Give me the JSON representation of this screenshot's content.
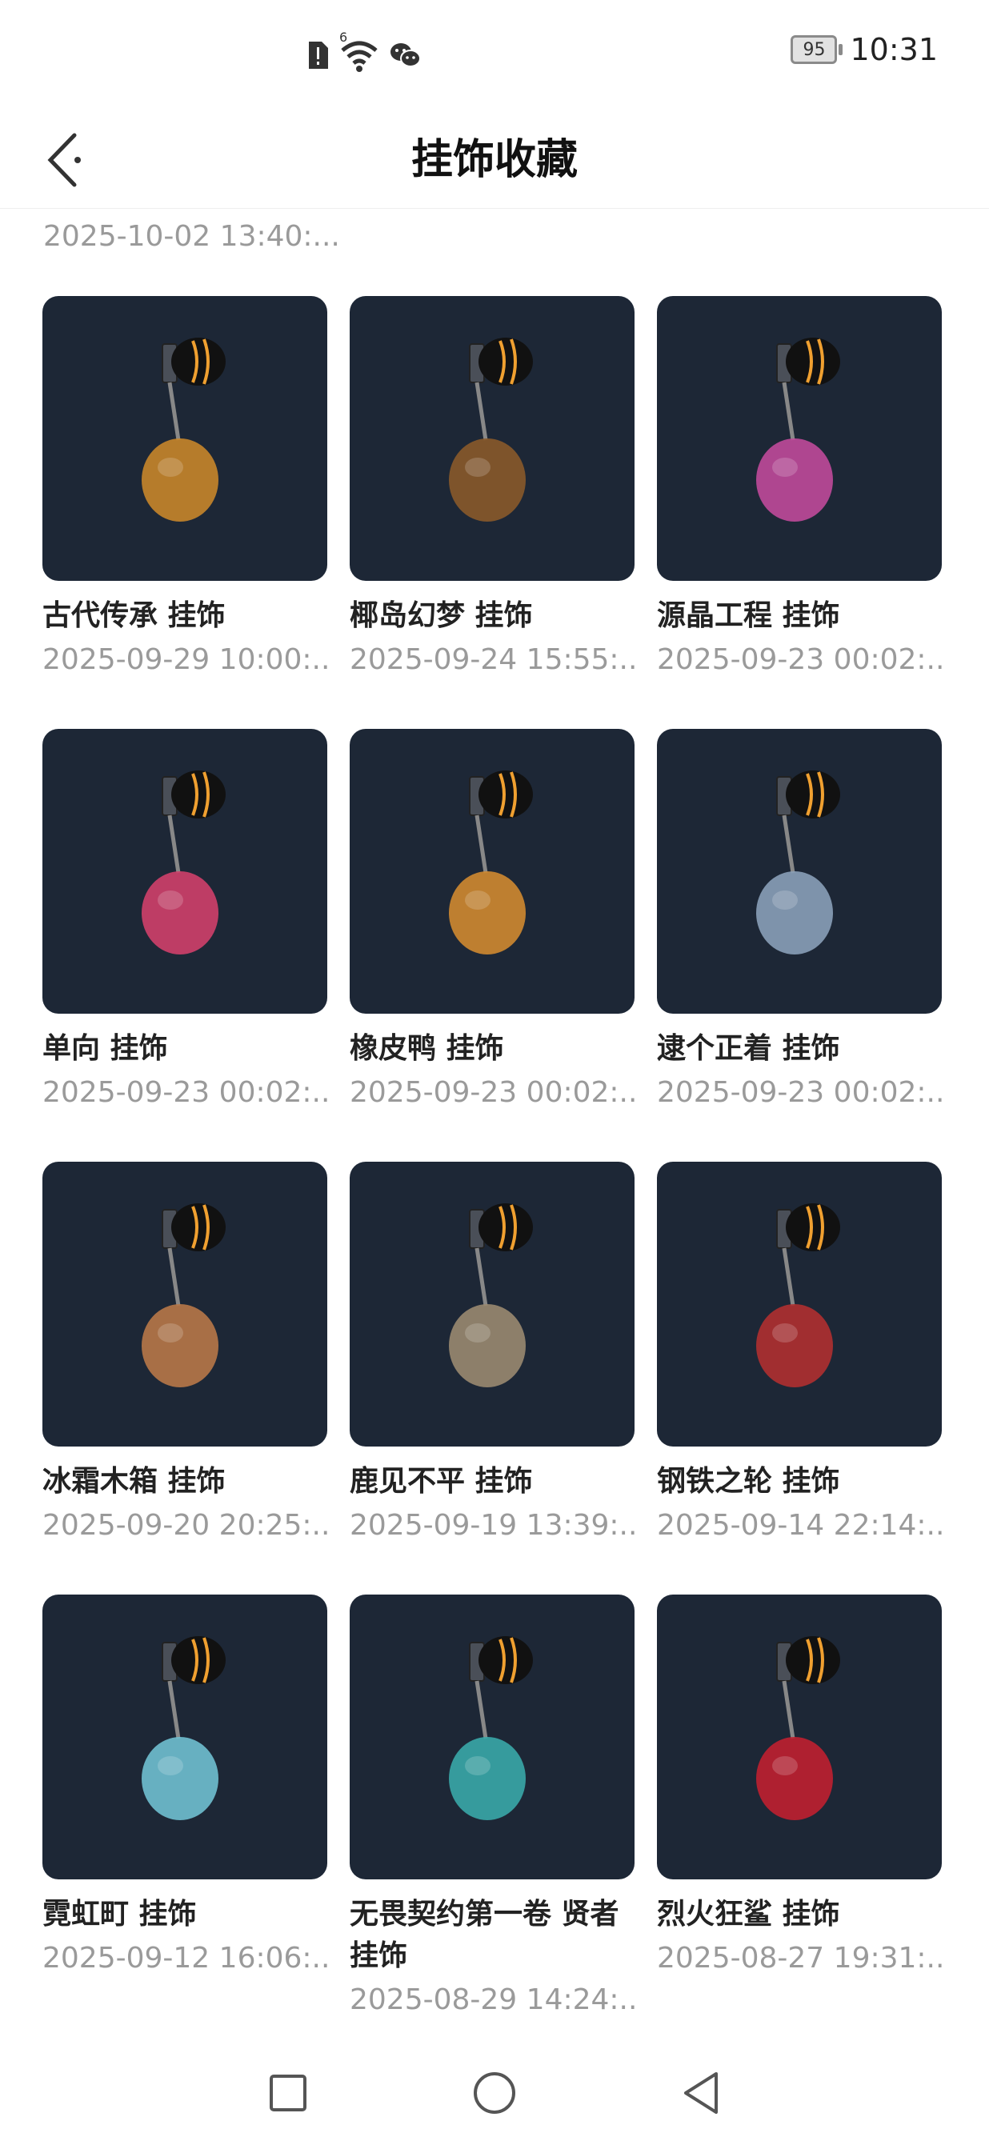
{
  "status": {
    "time": "10:31",
    "battery": "95",
    "signal_label": "6"
  },
  "header": {
    "title": "挂饰收藏"
  },
  "partial_item": {
    "date": "2025-10-02 13:40:..."
  },
  "items": [
    {
      "name": "古代传承 挂饰",
      "date": "2025-09-29 10:00:..."
    },
    {
      "name": "椰岛幻梦 挂饰",
      "date": "2025-09-24 15:55:..."
    },
    {
      "name": "源晶工程 挂饰",
      "date": "2025-09-23 00:02:..."
    },
    {
      "name": "单向 挂饰",
      "date": "2025-09-23 00:02:..."
    },
    {
      "name": "橡皮鸭 挂饰",
      "date": "2025-09-23 00:02:..."
    },
    {
      "name": "逮个正着 挂饰",
      "date": "2025-09-23 00:02:..."
    },
    {
      "name": "冰霜木箱 挂饰",
      "date": "2025-09-20 20:25:..."
    },
    {
      "name": "鹿见不平 挂饰",
      "date": "2025-09-19 13:39:..."
    },
    {
      "name": "钢铁之轮 挂饰",
      "date": "2025-09-14 22:14:..."
    },
    {
      "name": "霓虹町 挂饰",
      "date": "2025-09-12 16:06:..."
    },
    {
      "name": "无畏契约第一卷 贤者 挂饰",
      "date": "2025-08-29 14:24:..."
    },
    {
      "name": "烈火狂鲨 挂饰",
      "date": "2025-08-27 19:31:..."
    }
  ],
  "colors": {
    "thumb_bg": "#1d2736",
    "ring_accent": "#f0a030",
    "date_gray": "#9a9a9a"
  },
  "nav": {
    "icons": [
      "recent-apps-icon",
      "home-icon",
      "back-triangle-icon"
    ]
  }
}
